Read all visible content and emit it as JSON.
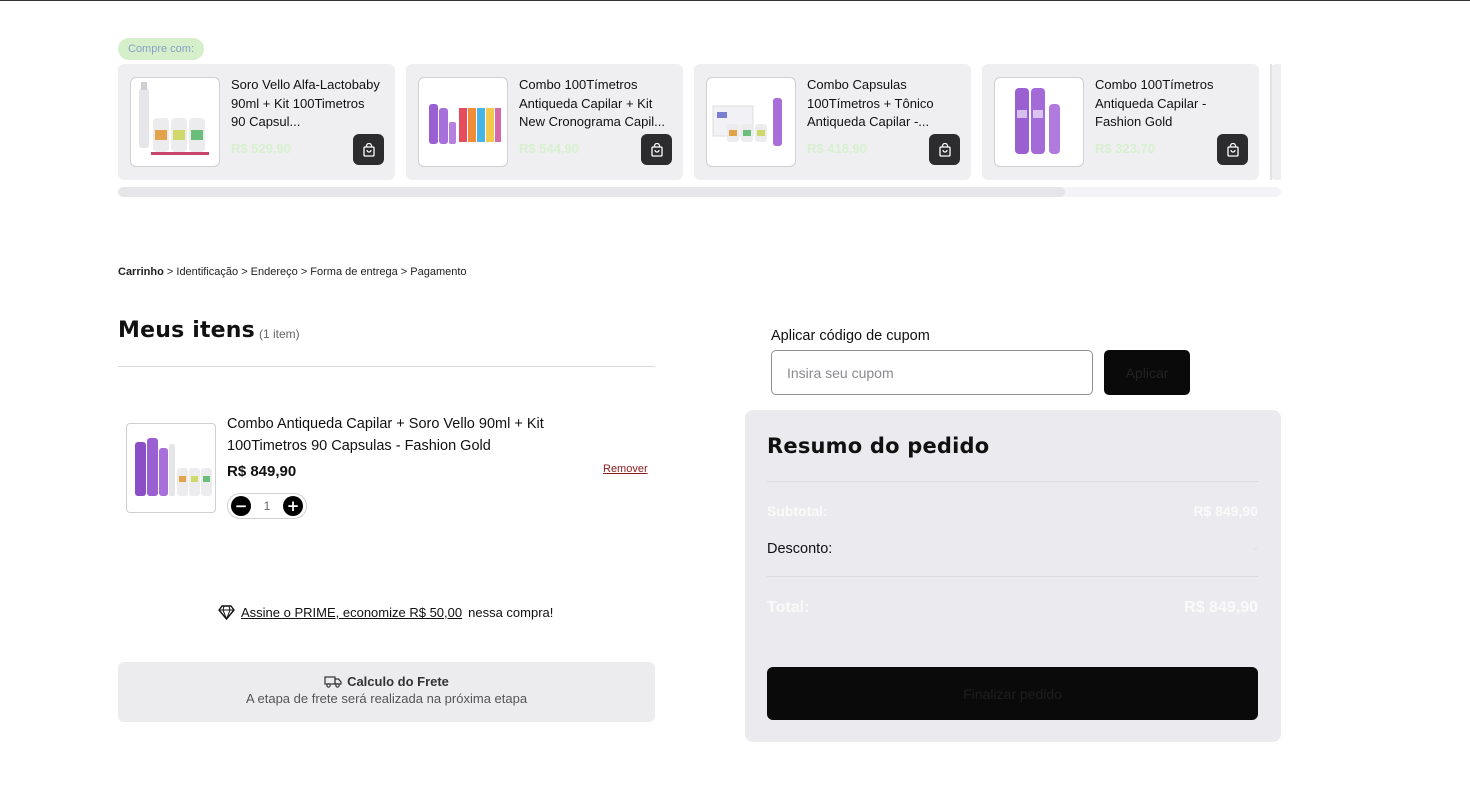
{
  "compre_com": {
    "label": "Compre com:",
    "products": [
      {
        "title": "Soro Vello Alfa-Lactobaby 90ml + Kit 100Timetros 90 Capsul...",
        "price": "R$ 529,90"
      },
      {
        "title": "Combo 100Tímetros Antiqueda Capilar + Kit New Cronograma Capil...",
        "price": "R$ 544,90"
      },
      {
        "title": "Combo Capsulas 100Tímetros + Tônico Antiqueda Capilar -...",
        "price": "R$ 418,90"
      },
      {
        "title": "Combo 100Tímetros Antiqueda Capilar - Fashion Gold",
        "price": "R$ 323,70"
      }
    ]
  },
  "breadcrumb": {
    "current": "Carrinho",
    "steps": "> Identificação > Endereço > Forma de entrega > Pagamento"
  },
  "items": {
    "title": "Meus itens",
    "count": "(1 item)",
    "list": [
      {
        "name": "Combo Antiqueda Capilar + Soro Vello 90ml + Kit 100Timetros 90 Capsulas - Fashion Gold",
        "price": "R$ 849,90",
        "remove_label": "Remover",
        "quantity": "1"
      }
    ]
  },
  "prime": {
    "link_text": "Assine o PRIME, economize R$ 50,00",
    "suffix": "nessa compra!"
  },
  "frete": {
    "title": "Calculo do Frete",
    "subtitle": "A etapa de frete será realizada na próxima etapa"
  },
  "cupom": {
    "label": "Aplicar código de cupom",
    "placeholder": "Insira seu cupom",
    "button": "Aplicar"
  },
  "resumo": {
    "title": "Resumo do pedido",
    "subtotal_label": "Subtotal:",
    "subtotal_value": "R$ 849,90",
    "desconto_label": "Desconto:",
    "desconto_value": "-",
    "total_label": "Total:",
    "total_value": "R$ 849,90",
    "finalize_button": "Finalizar pedido"
  }
}
